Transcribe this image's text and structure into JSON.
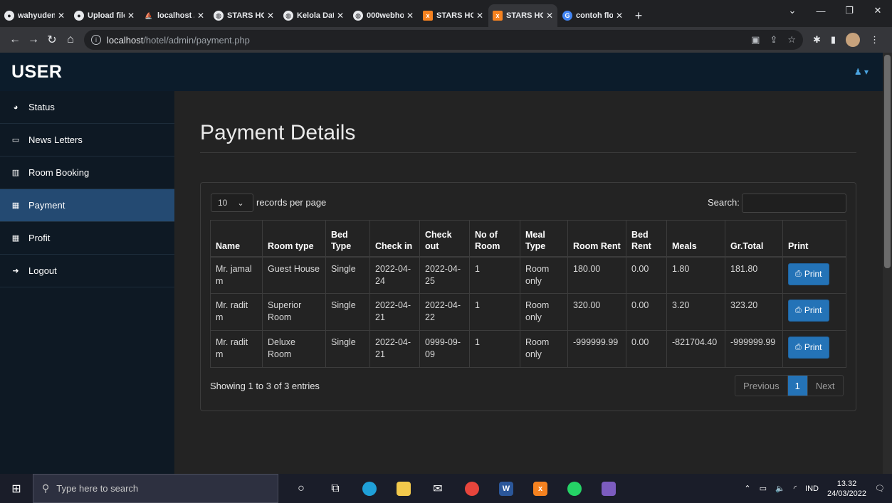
{
  "browser": {
    "tabs": [
      {
        "label": "wahyuden",
        "icon": "github-icon"
      },
      {
        "label": "Upload file",
        "icon": "github-icon"
      },
      {
        "label": "localhost /",
        "icon": "phpmyadmin-icon"
      },
      {
        "label": "STARS HO",
        "icon": "globe-icon"
      },
      {
        "label": "Kelola Dat",
        "icon": "globe-icon"
      },
      {
        "label": "000webho",
        "icon": "globe-icon"
      },
      {
        "label": "STARS HO",
        "icon": "xampp-icon"
      },
      {
        "label": "STARS HO",
        "icon": "xampp-icon"
      },
      {
        "label": "contoh flo",
        "icon": "google-icon"
      }
    ],
    "active_tab_index": 7,
    "url_host": "localhost",
    "url_path": "/hotel/admin/payment.php"
  },
  "app": {
    "brand": "USER",
    "sidebar": [
      {
        "label": "Status",
        "icon": "dashboard-icon"
      },
      {
        "label": "News Letters",
        "icon": "desktop-icon"
      },
      {
        "label": "Room Booking",
        "icon": "bar-chart-icon"
      },
      {
        "label": "Payment",
        "icon": "qrcode-icon",
        "active": true
      },
      {
        "label": "Profit",
        "icon": "qrcode-icon"
      },
      {
        "label": "Logout",
        "icon": "sign-out-icon"
      }
    ]
  },
  "main": {
    "title": "Payment Details",
    "records_per_page": "10",
    "records_label": "records per page",
    "search_label": "Search:",
    "search_value": "",
    "columns": [
      "Name",
      "Room type",
      "Bed Type",
      "Check in",
      "Check out",
      "No of Room",
      "Meal Type",
      "Room Rent",
      "Bed Rent",
      "Meals",
      "Gr.Total",
      "Print"
    ],
    "rows": [
      [
        "Mr. jamal m",
        "Guest House",
        "Single",
        "2022-04-24",
        "2022-04-25",
        "1",
        "Room only",
        "180.00",
        "0.00",
        "1.80",
        "181.80"
      ],
      [
        "Mr. radit m",
        "Superior Room",
        "Single",
        "2022-04-21",
        "2022-04-22",
        "1",
        "Room only",
        "320.00",
        "0.00",
        "3.20",
        "323.20"
      ],
      [
        "Mr. radit m",
        "Deluxe Room",
        "Single",
        "2022-04-21",
        "0999-09-09",
        "1",
        "Room only",
        "-999999.99",
        "0.00",
        "-821704.40",
        "-999999.99"
      ]
    ],
    "print_label": "Print",
    "info": "Showing 1 to 3 of 3 entries",
    "pager": {
      "previous": "Previous",
      "current": "1",
      "next": "Next"
    }
  },
  "taskbar": {
    "search_placeholder": "Type here to search",
    "lang": "IND",
    "time": "13.32",
    "date": "24/03/2022"
  }
}
